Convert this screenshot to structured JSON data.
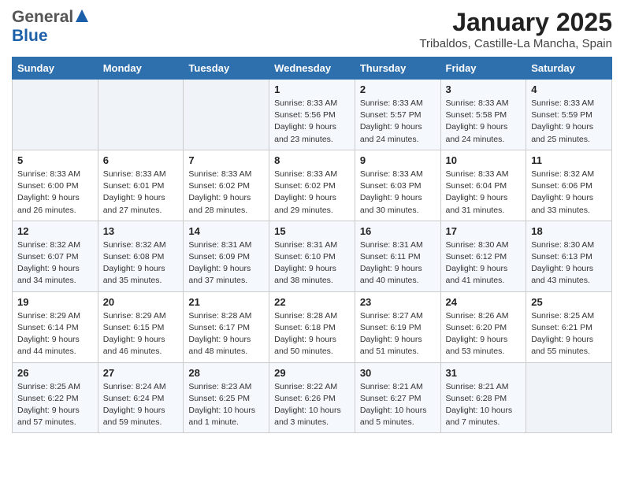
{
  "header": {
    "logo_general": "General",
    "logo_blue": "Blue",
    "title": "January 2025",
    "subtitle": "Tribaldos, Castille-La Mancha, Spain"
  },
  "weekdays": [
    "Sunday",
    "Monday",
    "Tuesday",
    "Wednesday",
    "Thursday",
    "Friday",
    "Saturday"
  ],
  "weeks": [
    [
      {
        "day": "",
        "info": ""
      },
      {
        "day": "",
        "info": ""
      },
      {
        "day": "",
        "info": ""
      },
      {
        "day": "1",
        "info": "Sunrise: 8:33 AM\nSunset: 5:56 PM\nDaylight: 9 hours\nand 23 minutes."
      },
      {
        "day": "2",
        "info": "Sunrise: 8:33 AM\nSunset: 5:57 PM\nDaylight: 9 hours\nand 24 minutes."
      },
      {
        "day": "3",
        "info": "Sunrise: 8:33 AM\nSunset: 5:58 PM\nDaylight: 9 hours\nand 24 minutes."
      },
      {
        "day": "4",
        "info": "Sunrise: 8:33 AM\nSunset: 5:59 PM\nDaylight: 9 hours\nand 25 minutes."
      }
    ],
    [
      {
        "day": "5",
        "info": "Sunrise: 8:33 AM\nSunset: 6:00 PM\nDaylight: 9 hours\nand 26 minutes."
      },
      {
        "day": "6",
        "info": "Sunrise: 8:33 AM\nSunset: 6:01 PM\nDaylight: 9 hours\nand 27 minutes."
      },
      {
        "day": "7",
        "info": "Sunrise: 8:33 AM\nSunset: 6:02 PM\nDaylight: 9 hours\nand 28 minutes."
      },
      {
        "day": "8",
        "info": "Sunrise: 8:33 AM\nSunset: 6:02 PM\nDaylight: 9 hours\nand 29 minutes."
      },
      {
        "day": "9",
        "info": "Sunrise: 8:33 AM\nSunset: 6:03 PM\nDaylight: 9 hours\nand 30 minutes."
      },
      {
        "day": "10",
        "info": "Sunrise: 8:33 AM\nSunset: 6:04 PM\nDaylight: 9 hours\nand 31 minutes."
      },
      {
        "day": "11",
        "info": "Sunrise: 8:32 AM\nSunset: 6:06 PM\nDaylight: 9 hours\nand 33 minutes."
      }
    ],
    [
      {
        "day": "12",
        "info": "Sunrise: 8:32 AM\nSunset: 6:07 PM\nDaylight: 9 hours\nand 34 minutes."
      },
      {
        "day": "13",
        "info": "Sunrise: 8:32 AM\nSunset: 6:08 PM\nDaylight: 9 hours\nand 35 minutes."
      },
      {
        "day": "14",
        "info": "Sunrise: 8:31 AM\nSunset: 6:09 PM\nDaylight: 9 hours\nand 37 minutes."
      },
      {
        "day": "15",
        "info": "Sunrise: 8:31 AM\nSunset: 6:10 PM\nDaylight: 9 hours\nand 38 minutes."
      },
      {
        "day": "16",
        "info": "Sunrise: 8:31 AM\nSunset: 6:11 PM\nDaylight: 9 hours\nand 40 minutes."
      },
      {
        "day": "17",
        "info": "Sunrise: 8:30 AM\nSunset: 6:12 PM\nDaylight: 9 hours\nand 41 minutes."
      },
      {
        "day": "18",
        "info": "Sunrise: 8:30 AM\nSunset: 6:13 PM\nDaylight: 9 hours\nand 43 minutes."
      }
    ],
    [
      {
        "day": "19",
        "info": "Sunrise: 8:29 AM\nSunset: 6:14 PM\nDaylight: 9 hours\nand 44 minutes."
      },
      {
        "day": "20",
        "info": "Sunrise: 8:29 AM\nSunset: 6:15 PM\nDaylight: 9 hours\nand 46 minutes."
      },
      {
        "day": "21",
        "info": "Sunrise: 8:28 AM\nSunset: 6:17 PM\nDaylight: 9 hours\nand 48 minutes."
      },
      {
        "day": "22",
        "info": "Sunrise: 8:28 AM\nSunset: 6:18 PM\nDaylight: 9 hours\nand 50 minutes."
      },
      {
        "day": "23",
        "info": "Sunrise: 8:27 AM\nSunset: 6:19 PM\nDaylight: 9 hours\nand 51 minutes."
      },
      {
        "day": "24",
        "info": "Sunrise: 8:26 AM\nSunset: 6:20 PM\nDaylight: 9 hours\nand 53 minutes."
      },
      {
        "day": "25",
        "info": "Sunrise: 8:25 AM\nSunset: 6:21 PM\nDaylight: 9 hours\nand 55 minutes."
      }
    ],
    [
      {
        "day": "26",
        "info": "Sunrise: 8:25 AM\nSunset: 6:22 PM\nDaylight: 9 hours\nand 57 minutes."
      },
      {
        "day": "27",
        "info": "Sunrise: 8:24 AM\nSunset: 6:24 PM\nDaylight: 9 hours\nand 59 minutes."
      },
      {
        "day": "28",
        "info": "Sunrise: 8:23 AM\nSunset: 6:25 PM\nDaylight: 10 hours\nand 1 minute."
      },
      {
        "day": "29",
        "info": "Sunrise: 8:22 AM\nSunset: 6:26 PM\nDaylight: 10 hours\nand 3 minutes."
      },
      {
        "day": "30",
        "info": "Sunrise: 8:21 AM\nSunset: 6:27 PM\nDaylight: 10 hours\nand 5 minutes."
      },
      {
        "day": "31",
        "info": "Sunrise: 8:21 AM\nSunset: 6:28 PM\nDaylight: 10 hours\nand 7 minutes."
      },
      {
        "day": "",
        "info": ""
      }
    ]
  ]
}
